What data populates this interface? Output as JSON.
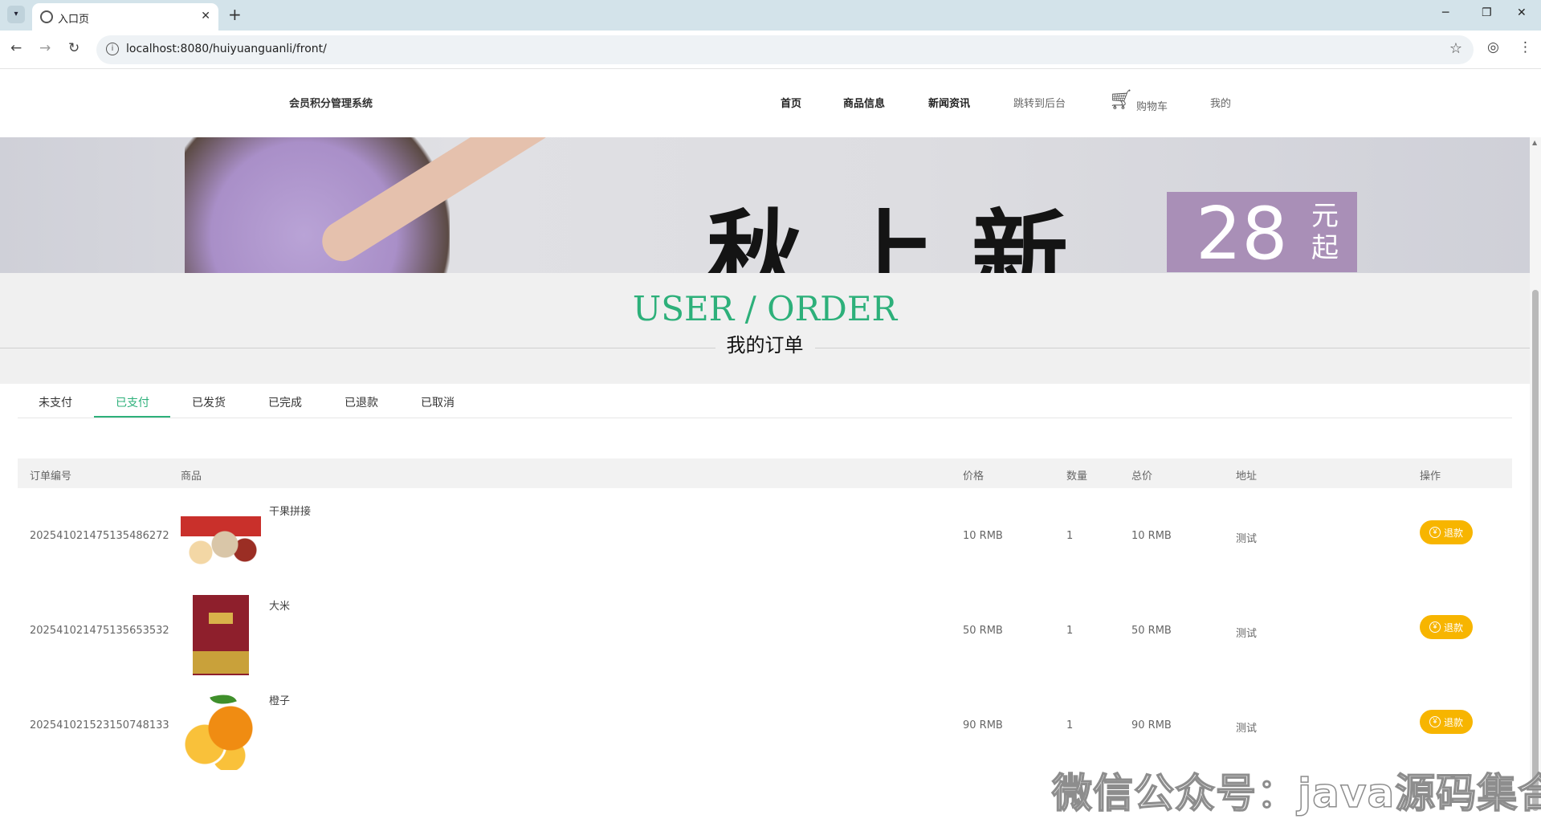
{
  "browser": {
    "tab_title": "入口页",
    "url": "localhost:8080/huiyuanguanli/front/"
  },
  "header": {
    "site_title": "会员积分管理系统",
    "nav": {
      "home": "首页",
      "products": "商品信息",
      "news": "新闻资讯",
      "backend": "跳转到后台",
      "cart": "购物车",
      "mine": "我的"
    }
  },
  "banner": {
    "headline": "秋上新",
    "price": "28",
    "price_unit": "元起"
  },
  "section": {
    "title_en": "USER / ORDER",
    "title_cn": "我的订单"
  },
  "status_tabs": {
    "unpaid": "未支付",
    "paid": "已支付",
    "shipped": "已发货",
    "completed": "已完成",
    "refunded": "已退款",
    "cancelled": "已取消",
    "active": "已支付"
  },
  "table": {
    "headers": {
      "order_no": "订单编号",
      "product": "商品",
      "price": "价格",
      "quantity": "数量",
      "total": "总价",
      "address": "地址",
      "action": "操作"
    },
    "rows": [
      {
        "order_no": "20254102147513548627​2",
        "name": "干果拼接",
        "price": "10 RMB",
        "quantity": "1",
        "total": "10 RMB",
        "address": "测试",
        "action": "退款",
        "thumb": "mixed-nuts"
      },
      {
        "order_no": "202541021475135653532",
        "name": "大米",
        "price": "50 RMB",
        "quantity": "1",
        "total": "50 RMB",
        "address": "测试",
        "action": "退款",
        "thumb": "rice-bag"
      },
      {
        "order_no": "202541021523150748133",
        "name": "橙子",
        "price": "90 RMB",
        "quantity": "1",
        "total": "90 RMB",
        "address": "测试",
        "action": "退款",
        "thumb": "oranges"
      }
    ]
  },
  "watermark": "微信公众号：java源码集合",
  "colors": {
    "accent": "#2db07a",
    "refund_button": "#f7b500",
    "section_bg": "#f0f0f0"
  }
}
